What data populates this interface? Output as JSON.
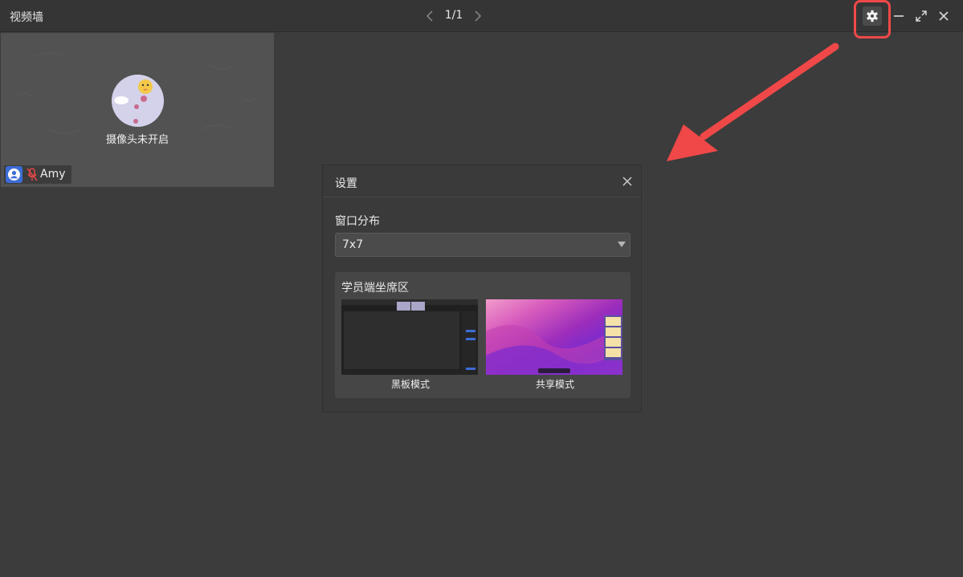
{
  "window": {
    "title": "视频墙",
    "page_indicator": "1/1"
  },
  "video_tile": {
    "camera_status": "摄像头未开启",
    "participant_name": "Amy",
    "mic": "muted"
  },
  "settings_dialog": {
    "title": "设置",
    "layout_label": "窗口分布",
    "layout_value": "7x7",
    "seat_area_label": "学员端坐席区",
    "modes": [
      {
        "label": "黑板模式"
      },
      {
        "label": "共享模式"
      }
    ]
  },
  "colors": {
    "background": "#3c3c3c",
    "titlebar": "#353535",
    "highlight": "#f04848",
    "role_badge": "#3b6cd8",
    "mic_muted": "#e04747"
  },
  "icons": [
    "chevron-left-icon",
    "chevron-right-icon",
    "gear-icon",
    "minimize-icon",
    "expand-icon",
    "close-icon",
    "user-icon",
    "mic-muted-icon",
    "caret-down-icon"
  ]
}
